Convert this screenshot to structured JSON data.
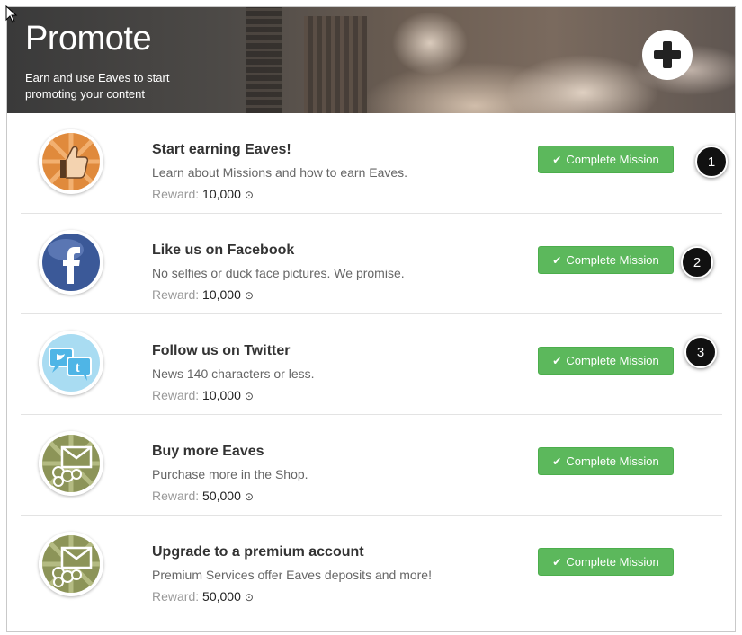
{
  "banner": {
    "title": "Promote",
    "subtitle": "Earn and use Eaves to start promoting your content",
    "add_icon": "plus-circle-icon"
  },
  "reward_label": "Reward:",
  "missions": [
    {
      "title": "Start earning Eaves!",
      "description": "Learn about Missions and how to earn Eaves.",
      "reward": "10,000",
      "button": "Complete Mission",
      "icon": "thumbs-up-badge",
      "step": "1"
    },
    {
      "title": "Like us on Facebook",
      "description": "No selfies or duck face pictures. We promise.",
      "reward": "10,000",
      "button": "Complete Mission",
      "icon": "facebook-badge",
      "step": "2"
    },
    {
      "title": "Follow us on Twitter",
      "description": "News 140 characters or less.",
      "reward": "10,000",
      "button": "Complete Mission",
      "icon": "twitter-badge",
      "step": "3"
    },
    {
      "title": "Buy more Eaves",
      "description": "Purchase more in the Shop.",
      "reward": "50,000",
      "button": "Complete Mission",
      "icon": "envelope-coins-badge",
      "step": ""
    },
    {
      "title": "Upgrade to a premium account",
      "description": "Premium Services offer Eaves deposits and more!",
      "reward": "50,000",
      "button": "Complete Mission",
      "icon": "envelope-coins-badge",
      "step": ""
    }
  ],
  "colors": {
    "button_green": "#5cb85c",
    "step_marker": "#111111"
  }
}
